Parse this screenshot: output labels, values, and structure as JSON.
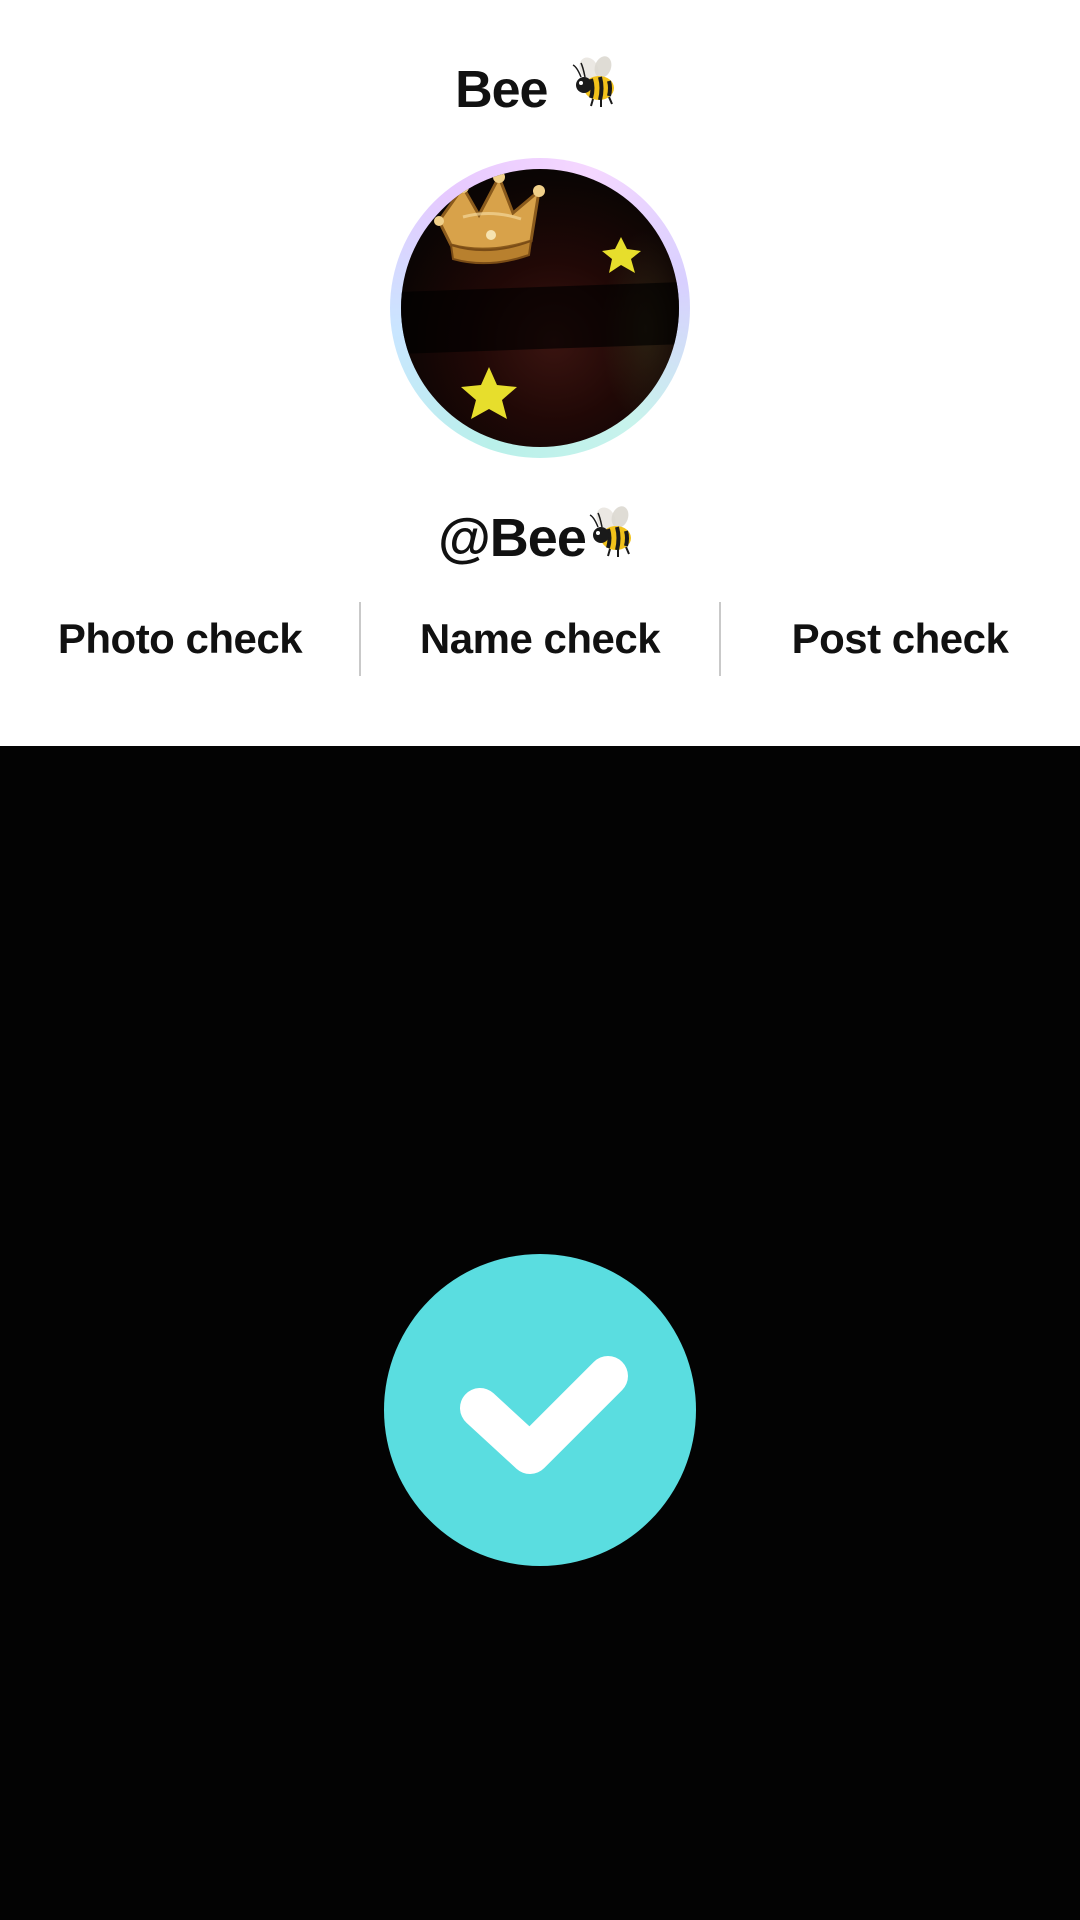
{
  "profile": {
    "display_name": "Bee",
    "handle": "@Bee",
    "name_emoji": "bee-icon",
    "avatar": {
      "description_icon": "avatar-crown-stars",
      "ring_colors": [
        "#b9f0ea",
        "#c9e6ff",
        "#e6c9ff",
        "#f5d7ff"
      ]
    }
  },
  "checks": {
    "items": [
      {
        "label": "Photo check"
      },
      {
        "label": "Name check"
      },
      {
        "label": "Post check"
      }
    ]
  },
  "status": {
    "icon": "checkmark-icon",
    "color": "#5adde0"
  }
}
